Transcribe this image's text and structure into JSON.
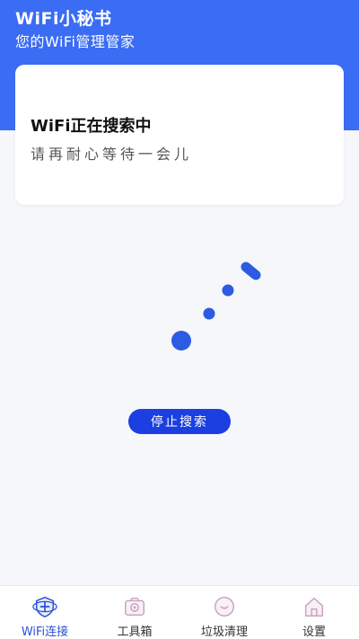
{
  "header": {
    "title": "WiFi小秘书",
    "subtitle": "您的WiFi管理管家",
    "bg_color": "#3a6cf4"
  },
  "status_card": {
    "title": "WiFi正在搜索中",
    "subtitle": "请再耐心等待一会儿"
  },
  "search": {
    "stop_label": "停止搜索",
    "button_color": "#1b3fe0",
    "spinner_icon": "loading-dots-icon",
    "spinner_color": "#2d5be3"
  },
  "tabbar": {
    "tabs": [
      {
        "label": "WiFi连接",
        "icon": "wifi-shield-icon",
        "active": true
      },
      {
        "label": "工具箱",
        "icon": "toolbox-icon",
        "active": false
      },
      {
        "label": "垃圾清理",
        "icon": "clean-icon",
        "active": false
      },
      {
        "label": "设置",
        "icon": "home-icon",
        "active": false
      }
    ],
    "active_color": "#2a50d8"
  }
}
